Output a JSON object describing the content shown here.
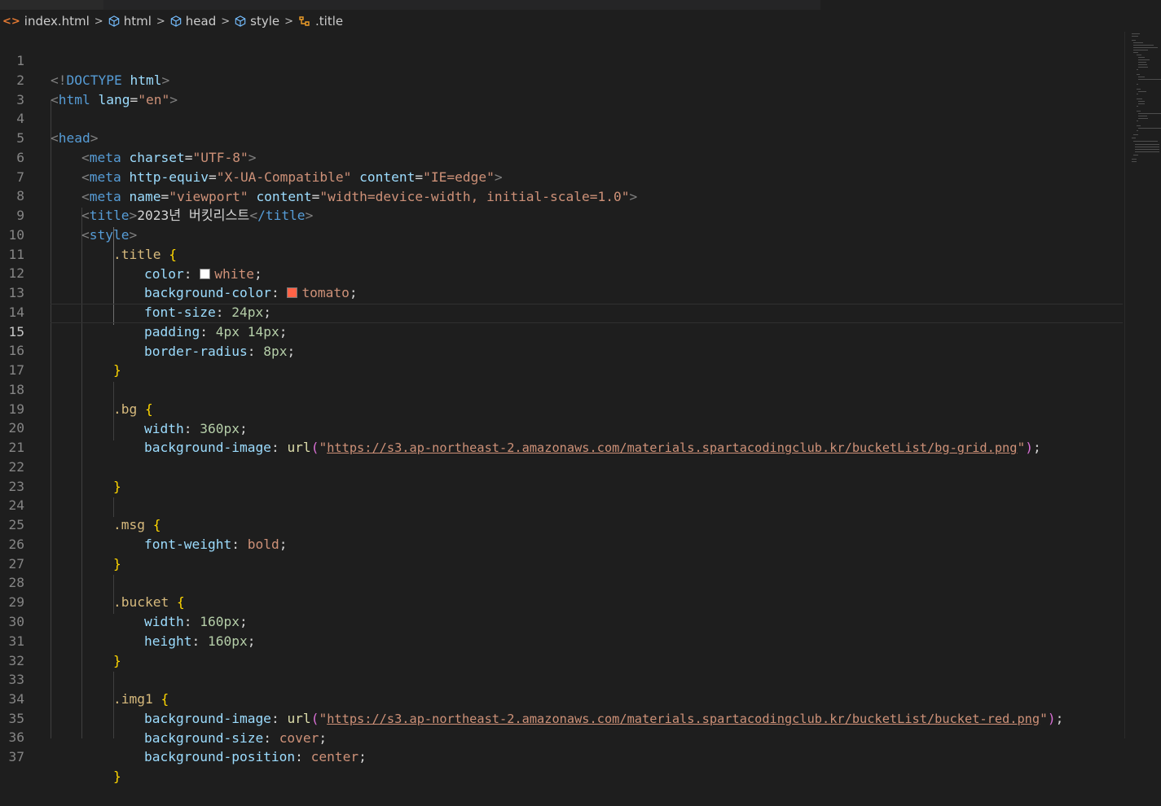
{
  "breadcrumb": {
    "items": [
      {
        "label": "index.html",
        "icon": "html-file-icon"
      },
      {
        "label": "html",
        "icon": "element-cube-icon"
      },
      {
        "label": "head",
        "icon": "element-cube-icon"
      },
      {
        "label": "style",
        "icon": "element-cube-icon"
      },
      {
        "label": ".title",
        "icon": "css-rule-icon"
      }
    ]
  },
  "editor": {
    "current_line": 15,
    "line_numbers": [
      "1",
      "2",
      "3",
      "4",
      "5",
      "6",
      "7",
      "8",
      "9",
      "10",
      "11",
      "12",
      "13",
      "14",
      "15",
      "16",
      "17",
      "18",
      "19",
      "20",
      "21",
      "22",
      "23",
      "24",
      "25",
      "26",
      "27",
      "28",
      "29",
      "30",
      "31",
      "32",
      "33",
      "34",
      "35",
      "36",
      "37"
    ],
    "code": {
      "l1_doctype_open": "<!",
      "l1_doctype": "DOCTYPE",
      "l1_html": "html",
      "l1_close": ">",
      "l2_open": "<",
      "l2_tag": "html",
      "l2_attr": "lang",
      "l2_eq": "=",
      "l2_val": "\"en\"",
      "l2_close": ">",
      "l4_open": "<",
      "l4_tag": "head",
      "l4_close": ">",
      "l5_tag": "meta",
      "l5_attr": "charset",
      "l5_val": "\"UTF-8\"",
      "l6_tag": "meta",
      "l6_attr1": "http-equiv",
      "l6_val1": "\"X-UA-Compatible\"",
      "l6_attr2": "content",
      "l6_val2": "\"IE=edge\"",
      "l7_tag": "meta",
      "l7_attr1": "name",
      "l7_val1": "\"viewport\"",
      "l7_attr2": "content",
      "l7_val2": "\"width=device-width, initial-scale=1.0\"",
      "l8_tag": "title",
      "l8_text": "2023년 버킷리스트",
      "l8_endtag": "/title",
      "l9_tag": "style",
      "l10_sel": ".title",
      "l11_prop": "color",
      "l11_val": "white",
      "l12_prop": "background-color",
      "l12_val": "tomato",
      "l13_prop": "font-size",
      "l13_val": "24px",
      "l14_prop": "padding",
      "l14_val": "4px 14px",
      "l15_prop": "border-radius",
      "l15_val": "8px",
      "l18_sel": ".bg",
      "l19_prop": "width",
      "l19_val": "360px",
      "l20_prop": "background-image",
      "l20_fn": "url",
      "l20_url": "https://s3.ap-northeast-2.amazonaws.com/materials.spartacodingclub.kr/bucketList/bg-grid.png",
      "l24_sel": ".msg",
      "l25_prop": "font-weight",
      "l25_val": "bold",
      "l28_sel": ".bucket",
      "l29_prop": "width",
      "l29_val": "160px",
      "l30_prop": "height",
      "l30_val": "160px",
      "l33_sel": ".img1",
      "l34_prop": "background-image",
      "l34_fn": "url",
      "l34_url": "https://s3.ap-northeast-2.amazonaws.com/materials.spartacodingclub.kr/bucketList/bucket-red.png",
      "l35_prop": "background-size",
      "l35_val": "cover",
      "l36_prop": "background-position",
      "l36_val": "center"
    },
    "swatch_colors": {
      "white": "#ffffff",
      "tomato": "#ff6347"
    }
  }
}
